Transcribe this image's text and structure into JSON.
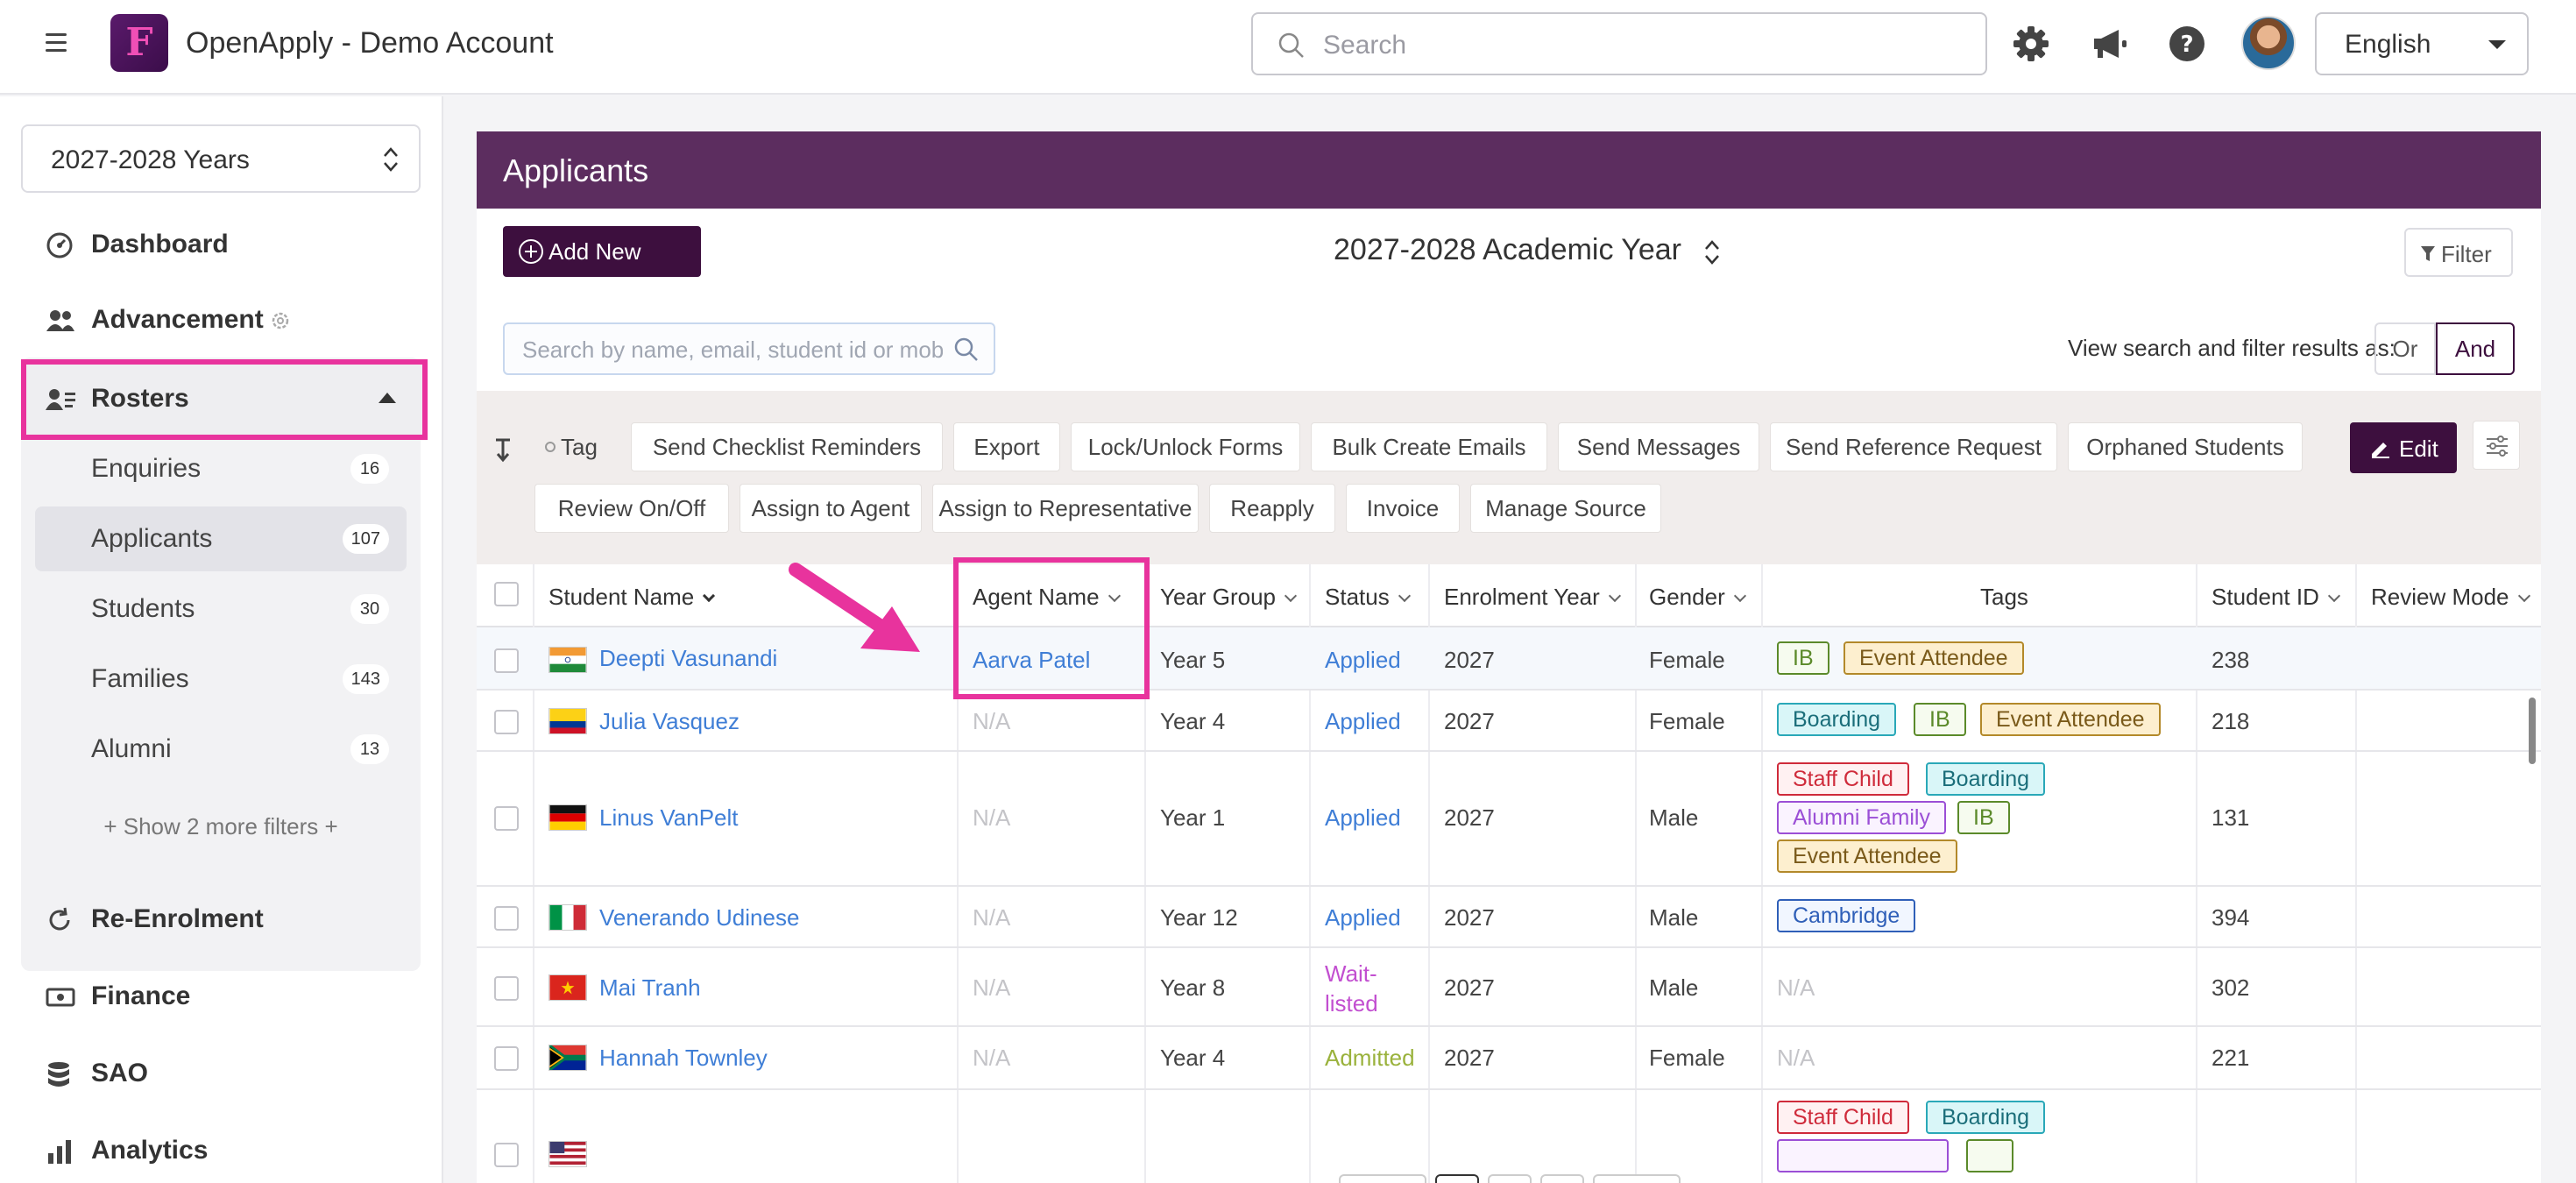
{
  "app": {
    "title": "OpenApply - Demo Account",
    "logo_letter": "F",
    "search_placeholder": "Search",
    "language": "English"
  },
  "sidebar": {
    "year_select": "2027-2028 Years",
    "nav": [
      {
        "label": "Dashboard",
        "icon": "dashboard-icon"
      },
      {
        "label": "Advancement",
        "icon": "people-icon"
      },
      {
        "label": "Rosters",
        "icon": "roster-icon"
      },
      {
        "label": "Re-Enrolment",
        "icon": "refresh-icon"
      },
      {
        "label": "Finance",
        "icon": "money-icon"
      },
      {
        "label": "SAO",
        "icon": "database-icon"
      },
      {
        "label": "Analytics",
        "icon": "bar-chart-icon"
      }
    ],
    "rosters_items": [
      {
        "label": "Enquiries",
        "count": "16"
      },
      {
        "label": "Applicants",
        "count": "107"
      },
      {
        "label": "Students",
        "count": "30"
      },
      {
        "label": "Families",
        "count": "143"
      },
      {
        "label": "Alumni",
        "count": "13"
      }
    ],
    "show_more": "+ Show 2 more filters +"
  },
  "main": {
    "header": "Applicants",
    "add_new": "Add New",
    "academic_year": "2027-2028 Academic Year",
    "filter": "Filter",
    "table_search_placeholder": "Search by name, email, student id or mobile",
    "view_label": "View search and filter results as:",
    "toggle_or": "Or",
    "toggle_and": "And",
    "edit": "Edit",
    "actions_row1": [
      "Tag",
      "Send Checklist Reminders",
      "Export",
      "Lock/Unlock Forms",
      "Bulk Create Emails",
      "Send Messages",
      "Send Reference Request",
      "Orphaned Students"
    ],
    "actions_row2": [
      "Review On/Off",
      "Assign to Agent",
      "Assign to Representative",
      "Reapply",
      "Invoice",
      "Manage Source"
    ]
  },
  "table": {
    "columns": [
      "Student Name",
      "Agent Name",
      "Year Group",
      "Status",
      "Enrolment Year",
      "Gender",
      "Tags",
      "Student ID",
      "Review Mode"
    ],
    "rows": [
      {
        "name": "Deepti Vasunandi",
        "agent": "Aarva Patel",
        "year": "Year 5",
        "status": "Applied",
        "enrol": "2027",
        "gender": "Female",
        "tags": [
          "IB",
          "Event Attendee"
        ],
        "id": "238",
        "flag": "india"
      },
      {
        "name": "Julia Vasquez",
        "agent": "N/A",
        "year": "Year 4",
        "status": "Applied",
        "enrol": "2027",
        "gender": "Female",
        "tags": [
          "Boarding",
          "IB",
          "Event Attendee"
        ],
        "id": "218",
        "flag": "colombia"
      },
      {
        "name": "Linus VanPelt",
        "agent": "N/A",
        "year": "Year 1",
        "status": "Applied",
        "enrol": "2027",
        "gender": "Male",
        "tags": [
          "Staff Child",
          "Boarding",
          "Alumni Family",
          "IB",
          "Event Attendee"
        ],
        "id": "131",
        "flag": "germany"
      },
      {
        "name": "Venerando Udinese",
        "agent": "N/A",
        "year": "Year 12",
        "status": "Applied",
        "enrol": "2027",
        "gender": "Male",
        "tags": [
          "Cambridge"
        ],
        "id": "394",
        "flag": "italy"
      },
      {
        "name": "Mai Tranh",
        "agent": "N/A",
        "year": "Year 8",
        "status_line1": "Wait-",
        "status_line2": "listed",
        "enrol": "2027",
        "gender": "Male",
        "tags_na": "N/A",
        "id": "302",
        "flag": "vietnam"
      },
      {
        "name": "Hannah Townley",
        "agent": "N/A",
        "year": "Year 4",
        "status": "Admitted",
        "enrol": "2027",
        "gender": "Female",
        "tags_na": "N/A",
        "id": "221",
        "flag": "southafrica"
      },
      {
        "tags": [
          "Staff Child",
          "Boarding"
        ]
      }
    ]
  },
  "colors": {
    "brand": "#5c2d5f",
    "brand_dark": "#3d0f3e",
    "highlight": "#e8339d",
    "link": "#3f7ed6"
  }
}
